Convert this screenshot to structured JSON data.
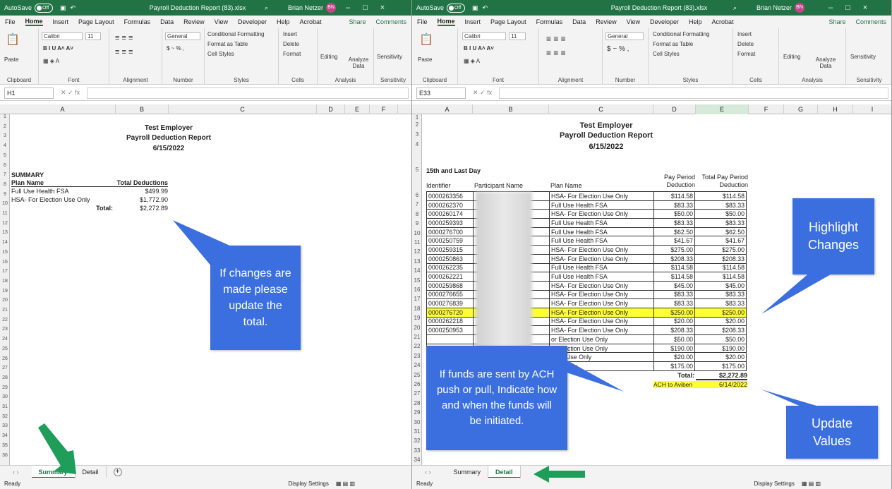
{
  "app": {
    "autosave": "AutoSave",
    "toggle": "Off",
    "title": "Payroll Deduction Report (83).xlsx",
    "user": "Brian Netzer",
    "initials": "BN"
  },
  "menu": [
    "File",
    "Home",
    "Insert",
    "Page Layout",
    "Formulas",
    "Data",
    "Review",
    "View",
    "Developer",
    "Help",
    "Acrobat"
  ],
  "share": "Share",
  "comments": "Comments",
  "ribbon": {
    "paste": "Paste",
    "font": "Calibri",
    "size": "11",
    "numfmt": "General",
    "cond": "Conditional Formatting",
    "fmt_table": "Format as Table",
    "cell_styles": "Cell Styles",
    "insert": "Insert",
    "delete": "Delete",
    "format": "Format",
    "editing": "Editing",
    "analyze": "Analyze Data",
    "sensitivity": "Sensitivity",
    "groups": [
      "Clipboard",
      "Font",
      "Alignment",
      "Number",
      "Styles",
      "Cells",
      "Analysis",
      "Sensitivity"
    ]
  },
  "left": {
    "namebox": "H1",
    "cols": [
      "A",
      "B",
      "C",
      "D",
      "E",
      "F"
    ],
    "title1": "Test Employer",
    "title2": "Payroll Deduction Report",
    "date": "6/15/2022",
    "summary": "SUMMARY",
    "plan_name": "Plan Name",
    "total_ded": "Total Deductions",
    "r1_name": "Full Use Health FSA",
    "r1_val": "$499.99",
    "r2_name": "HSA- For Election Use Only",
    "r2_val": "$1,772.90",
    "total_lbl": "Total:",
    "total_val": "$2,272.89",
    "tabs": [
      "Summary",
      "Detail"
    ],
    "status": "Ready",
    "display": "Display Settings"
  },
  "right": {
    "namebox": "E33",
    "cols": [
      "A",
      "B",
      "C",
      "D",
      "E",
      "F",
      "G",
      "H",
      "I"
    ],
    "title1": "Test Employer",
    "title2": "Payroll Deduction Report",
    "date": "6/15/2022",
    "section": "15th and Last Day",
    "h_identifier": "Identifier",
    "h_participant": "Participant Name",
    "h_plan": "Plan Name",
    "h_ppd": "Pay Period Deduction",
    "h_tppd": "Total Pay Period Deduction",
    "rows": [
      [
        "0000263356",
        "HSA- For Election Use Only",
        "$114.58",
        "$114.58"
      ],
      [
        "0000262370",
        "Full Use Health FSA",
        "$83.33",
        "$83.33"
      ],
      [
        "0000260174",
        "HSA- For Election Use Only",
        "$50.00",
        "$50.00"
      ],
      [
        "0000259393",
        "Full Use Health FSA",
        "$83.33",
        "$83.33"
      ],
      [
        "0000276700",
        "Full Use Health FSA",
        "$62.50",
        "$62.50"
      ],
      [
        "0000250759",
        "Full Use Health FSA",
        "$41.67",
        "$41.67"
      ],
      [
        "0000259315",
        "HSA- For Election Use Only",
        "$275.00",
        "$275.00"
      ],
      [
        "0000250863",
        "HSA- For Election Use Only",
        "$208.33",
        "$208.33"
      ],
      [
        "0000262235",
        "Full Use Health FSA",
        "$114.58",
        "$114.58"
      ],
      [
        "0000262221",
        "Full Use Health FSA",
        "$114.58",
        "$114.58"
      ],
      [
        "0000259868",
        "HSA- For Election Use Only",
        "$45.00",
        "$45.00"
      ],
      [
        "0000276655",
        "HSA- For Election Use Only",
        "$83.33",
        "$83.33"
      ],
      [
        "0000276839",
        "HSA- For Election Use Only",
        "$83.33",
        "$83.33"
      ],
      [
        "0000276720",
        "HSA- For Election Use Only",
        "$250.00",
        "$250.00"
      ],
      [
        "0000262218",
        "HSA- For Election Use Only",
        "$20.00",
        "$20.00"
      ],
      [
        "0000250953",
        "HSA- For Election Use Only",
        "$208.33",
        "$208.33"
      ],
      [
        "",
        "or Election Use Only",
        "$50.00",
        "$50.00"
      ],
      [
        "",
        "or Election Use Only",
        "$190.00",
        "$190.00"
      ],
      [
        "",
        "ction Use Only",
        "$20.00",
        "$20.00"
      ],
      [
        "",
        "Use Only",
        "$175.00",
        "$175.00"
      ]
    ],
    "total_lbl": "Total:",
    "total_val": "$2,272.89",
    "ach_lbl": "ACH to Aviben",
    "ach_date": "6/14/2022",
    "tabs": [
      "Summary",
      "Detail"
    ],
    "status": "Ready",
    "display": "Display Settings"
  },
  "callouts": {
    "update_total": "If changes are made please update the total.",
    "highlight": "Highlight Changes",
    "ach": "If funds are sent by ACH push or pull, Indicate how and when the funds will be initiated.",
    "update_values": "Update Values"
  },
  "colors": {
    "excel_green": "#217346",
    "callout_blue": "#3b6fe0",
    "highlight": "#ffff33",
    "arrow_green": "#1f9e5a"
  }
}
